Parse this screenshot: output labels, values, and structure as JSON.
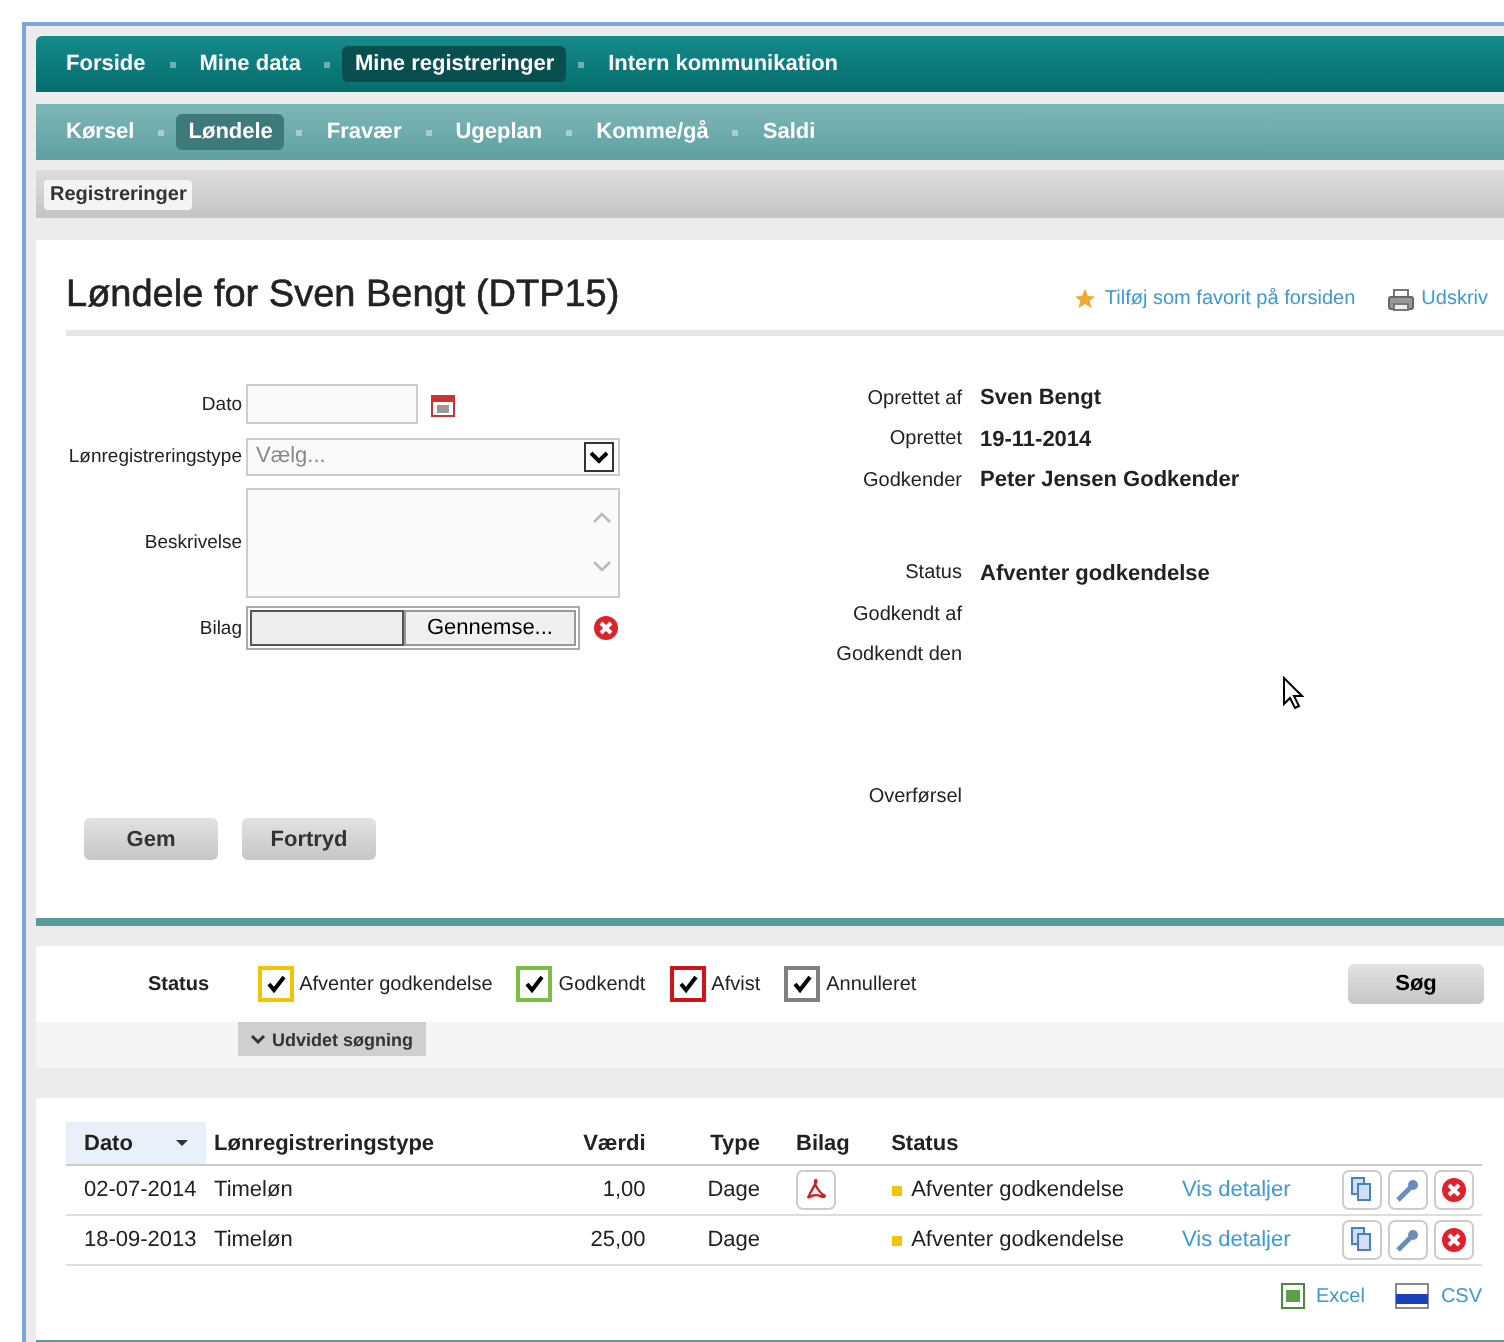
{
  "main_nav": [
    {
      "label": "Forside",
      "selected": false
    },
    {
      "label": "Mine data",
      "selected": false
    },
    {
      "label": "Mine registreringer",
      "selected": true
    },
    {
      "label": "Intern kommunikation",
      "selected": false
    }
  ],
  "sub_nav": [
    {
      "label": "Kørsel",
      "selected": false
    },
    {
      "label": "Løndele",
      "selected": true
    },
    {
      "label": "Fravær",
      "selected": false
    },
    {
      "label": "Ugeplan",
      "selected": false
    },
    {
      "label": "Komme/gå",
      "selected": false
    },
    {
      "label": "Saldi",
      "selected": false
    }
  ],
  "breadcrumb": "Registreringer",
  "page_title": "Løndele for Sven Bengt (DTP15)",
  "header_links": [
    {
      "kind": "favorite",
      "label": "Tilføj som favorit på forsiden"
    },
    {
      "kind": "print",
      "label": "Udskriv"
    }
  ],
  "form": {
    "date_label": "Dato",
    "type_label": "Lønregistreringstype",
    "type_placeholder": "Vælg...",
    "description_label": "Beskrivelse",
    "attachment_label": "Bilag",
    "browse_button": "Gennemse..."
  },
  "info_groups": [
    [
      {
        "label": "Oprettet af",
        "value": "Sven Bengt"
      },
      {
        "label": "Oprettet",
        "value": "19-11-2014"
      },
      {
        "label": "Godkender",
        "value": "Peter Jensen Godkender"
      }
    ],
    [
      {
        "label": "Status",
        "value": "Afventer godkendelse"
      },
      {
        "label": "Godkendt af"
      },
      {
        "label": "Godkendt den"
      }
    ],
    [
      {
        "label": "Overførsel"
      }
    ]
  ],
  "form_buttons": [
    "Gem",
    "Fortryd"
  ],
  "filter": {
    "label": "Status",
    "options": [
      {
        "label": "Afventer godkendelse",
        "checked": true,
        "color": "#f5c400"
      },
      {
        "label": "Godkendt",
        "checked": true,
        "color": "#7ac143"
      },
      {
        "label": "Afvist",
        "checked": true,
        "color": "#d0121b"
      },
      {
        "label": "Annulleret",
        "checked": true,
        "color": "#808080"
      }
    ],
    "search_button": "Søg",
    "advanced_toggle": "Udvidet søgning"
  },
  "table": {
    "columns": [
      "Dato",
      "Lønregistreringstype",
      "Værdi",
      "Type",
      "Bilag",
      "Status"
    ],
    "rows": [
      {
        "date": "02-07-2014",
        "type": "Timeløn",
        "value": "1,00",
        "unit": "Dage",
        "attachment": true,
        "status": "Afventer godkendelse",
        "color": "#f5c400",
        "link": "Vis detaljer"
      },
      {
        "date": "18-09-2013",
        "type": "Timeløn",
        "value": "25,00",
        "unit": "Dage",
        "attachment": false,
        "status": "Afventer godkendelse",
        "color": "#f5c400",
        "link": "Vis detaljer"
      }
    ]
  },
  "exports": [
    {
      "kind": "excel",
      "label": "Excel"
    },
    {
      "kind": "csv",
      "label": "CSV"
    }
  ]
}
